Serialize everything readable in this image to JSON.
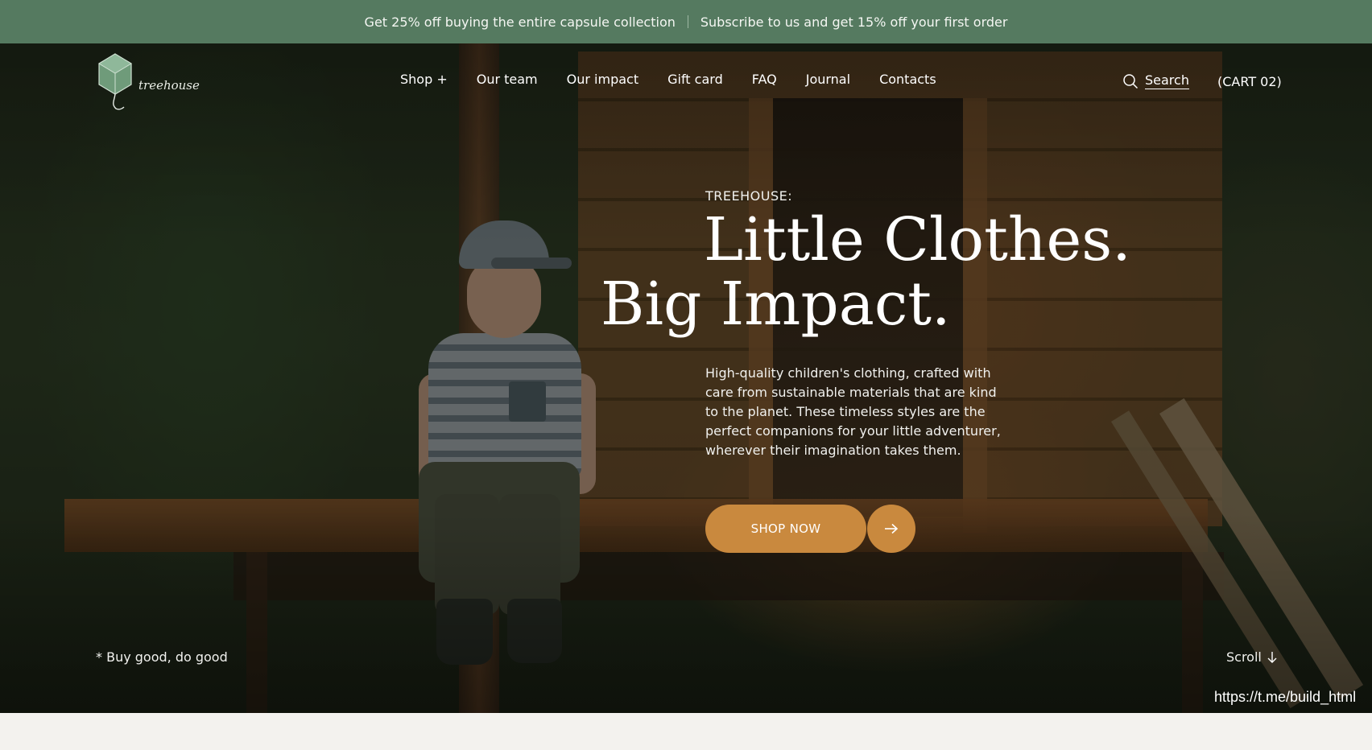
{
  "promo": {
    "left": "Get 25% off buying the entire capsule collection",
    "right": "Subscribe to us and get 15% off your first order"
  },
  "header": {
    "logo_text": "treehouse",
    "nav": [
      "Shop +",
      "Our team",
      "Our impact",
      "Gift card",
      "FAQ",
      "Journal",
      "Contacts"
    ],
    "search_label": "Search",
    "cart_label": "(CART 02)"
  },
  "hero": {
    "eyebrow": "TREEHOUSE:",
    "headline_line1": "Little Clothes.",
    "headline_line2": "Big Impact.",
    "description": "High-quality children's clothing, crafted with care from sustainable materials that are kind to the planet. These timeless styles are the perfect companions for your little adventurer, wherever their imagination takes them.",
    "cta_label": "SHOP NOW",
    "tagline": "* Buy good, do good",
    "scroll_label": "Scroll"
  },
  "watermark": "https://t.me/build_html",
  "colors": {
    "promo_bg": "#557a60",
    "cta": "#c9893e",
    "page_bg": "#f3f2ee"
  },
  "icons": [
    "leaf-logo-icon",
    "search-icon",
    "arrow-right-icon",
    "arrow-down-icon"
  ]
}
